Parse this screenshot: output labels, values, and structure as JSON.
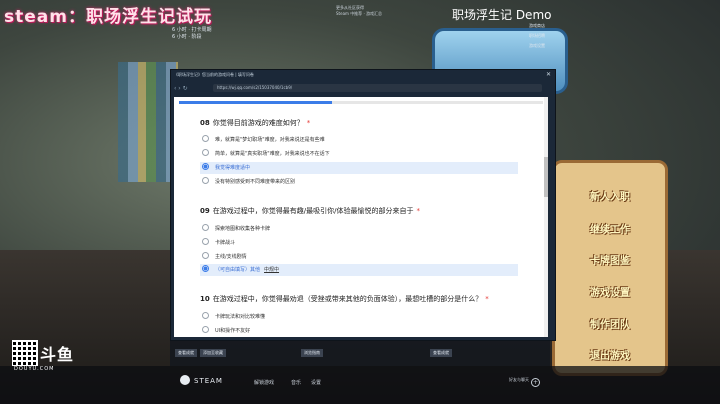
{
  "stream": {
    "title": "steam：职场浮生记试玩"
  },
  "schedule": [
    "6 小时 · 打卡周期",
    "6 小时 · 阶段"
  ],
  "top_center": [
    "更多从社区获得",
    "Steam 中推荐 · 游戏汇总"
  ],
  "game": {
    "title": "职场浮生记 Demo",
    "side_links": [
      "游戏商店",
      "职场招聘",
      "游戏设置"
    ]
  },
  "menu": [
    "新人入职",
    "继续工作",
    "卡牌图鉴",
    "游戏设置",
    "制作团队",
    "退出游戏"
  ],
  "window": {
    "title": "《职场浮生记》您当前的游戏问卷 | 填写问卷",
    "url": "https://wj.qq.com/s2/15037040/1cb9/",
    "progress": 0.42
  },
  "survey": {
    "q8": {
      "number": "08",
      "text": "你觉得目前游戏的难度如何？",
      "options": [
        "难，就算是\"梦幻职场\"难度，对我来说还是有些难",
        "简单，就算是\"真实职场\"难度，对我来说也不在话下",
        "我觉得难度适中",
        "没有特别感受到不同难度带来的区别"
      ],
      "selected": 2
    },
    "q9": {
      "number": "09",
      "text": "在游戏过程中，你觉得最有趣/最吸引你/体验最愉悦的部分来自于",
      "options": [
        "探索地图和收集各种卡牌",
        "卡牌战斗",
        "主线/支线剧情",
        "（可自由填写）其他"
      ],
      "selected": 3,
      "fill_value": "中规中"
    },
    "q10": {
      "number": "10",
      "text": "在游戏过程中，你觉得最劝退（受挫或带来其他的负面体验），最想吐槽的部分是什么？",
      "options": [
        "卡牌玩法和对比较难懂",
        "UI和操作不友好"
      ]
    }
  },
  "overlay_buttons": [
    "查看成就",
    "添加至收藏",
    "浏览指南",
    "查看成就"
  ],
  "taskbar": {
    "brand": "STEAM",
    "links": [
      "解锁游戏",
      "音乐",
      "设置"
    ],
    "friends": "好友与聊天"
  },
  "watermark": {
    "logo": "斗鱼",
    "sub": "DOUYU.COM"
  }
}
